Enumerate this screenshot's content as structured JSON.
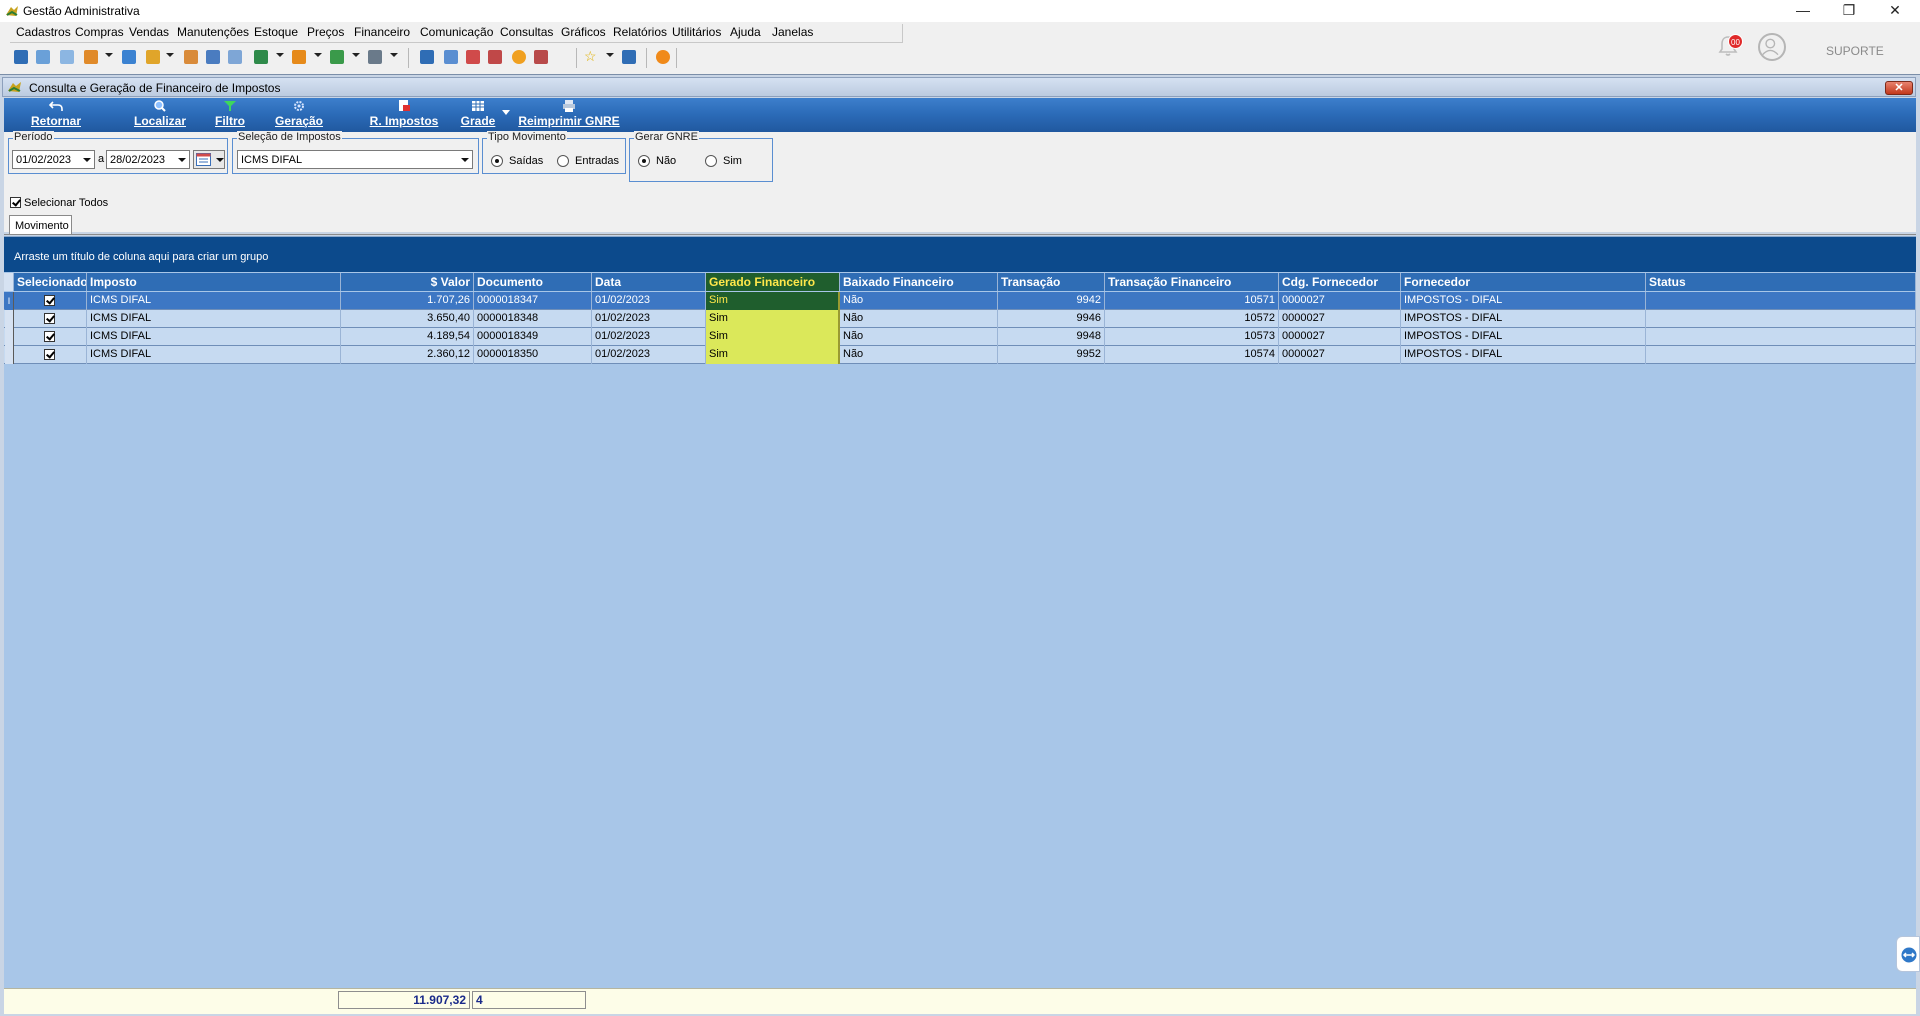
{
  "window": {
    "title": "Gestão Administrativa",
    "controls": {
      "minimize": "—",
      "restore": "❐",
      "close": "✕"
    }
  },
  "menu": [
    "Cadastros",
    "Compras",
    "Vendas",
    "Manutenções",
    "Estoque",
    "Preços",
    "Financeiro",
    "Comunicação",
    "Consultas",
    "Gráficos",
    "Relatórios",
    "Utilitários",
    "Ajuda",
    "Janelas"
  ],
  "topright": {
    "notification_count": "00",
    "user": "SUPORTE"
  },
  "child_window": {
    "title": "Consulta e Geração de Financeiro de Impostos",
    "close": "✕"
  },
  "ribbon": {
    "retornar": "Retornar",
    "localizar": "Localizar",
    "filtro": "Filtro",
    "geracao": "Geração",
    "r_impostos": "R. Impostos",
    "grade": "Grade",
    "reimprimir": "Reimprimir GNRE"
  },
  "filters": {
    "periodo": {
      "title": "Período",
      "from": "01/02/2023",
      "separator": "a",
      "to": "28/02/2023"
    },
    "selecao": {
      "title": "Seleção de Impostos",
      "value": "ICMS DIFAL"
    },
    "tipo": {
      "title": "Tipo Movimento",
      "options": [
        "Saídas",
        "Entradas"
      ],
      "selected": "Saídas"
    },
    "gnre": {
      "title": "Gerar GNRE",
      "options": [
        "Não",
        "Sim"
      ],
      "selected": "Não"
    },
    "selecionar_todos": "Selecionar Todos"
  },
  "tabs": [
    "Movimento"
  ],
  "grid": {
    "group_hint": "Arraste um título de coluna aqui para criar um grupo",
    "columns": [
      "Selecionado",
      "Imposto",
      "$ Valor",
      "Documento",
      "Data",
      "Gerado Financeiro",
      "Baixado Financeiro",
      "Transação",
      "Transação Financeiro",
      "Cdg. Fornecedor",
      "Fornecedor",
      "Status"
    ],
    "rows": [
      {
        "imposto": "ICMS DIFAL",
        "valor": "1.707,26",
        "documento": "0000018347",
        "data": "01/02/2023",
        "gerado": "Sim",
        "baixado": "Não",
        "transacao": "9942",
        "transacao_fin": "10571",
        "cdg": "0000027",
        "fornecedor": "IMPOSTOS - DIFAL",
        "status": ""
      },
      {
        "imposto": "ICMS DIFAL",
        "valor": "3.650,40",
        "documento": "0000018348",
        "data": "01/02/2023",
        "gerado": "Sim",
        "baixado": "Não",
        "transacao": "9946",
        "transacao_fin": "10572",
        "cdg": "0000027",
        "fornecedor": "IMPOSTOS - DIFAL",
        "status": ""
      },
      {
        "imposto": "ICMS DIFAL",
        "valor": "4.189,54",
        "documento": "0000018349",
        "data": "01/02/2023",
        "gerado": "Sim",
        "baixado": "Não",
        "transacao": "9948",
        "transacao_fin": "10573",
        "cdg": "0000027",
        "fornecedor": "IMPOSTOS - DIFAL",
        "status": ""
      },
      {
        "imposto": "ICMS DIFAL",
        "valor": "2.360,12",
        "documento": "0000018350",
        "data": "01/02/2023",
        "gerado": "Sim",
        "baixado": "Não",
        "transacao": "9952",
        "transacao_fin": "10574",
        "cdg": "0000027",
        "fornecedor": "IMPOSTOS - DIFAL",
        "status": ""
      }
    ]
  },
  "footer": {
    "total": "11.907,32",
    "count": "4"
  },
  "colors": {
    "ribbon": "#2c6cb9",
    "grid_bg": "#a8c6e8",
    "highlight": "#dbe85a",
    "group_panel": "#0c4a8c"
  }
}
